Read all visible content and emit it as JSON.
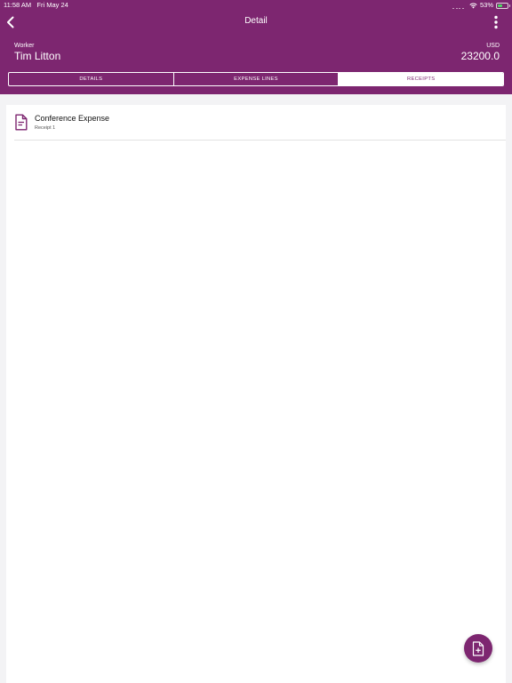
{
  "status_bar": {
    "time": "11:58 AM",
    "date": "Fri May 24",
    "battery": "53%",
    "battery_level": 0.53
  },
  "nav": {
    "title": "Detail",
    "back_icon": "chevron-left-icon",
    "more_icon": "more-vertical-icon"
  },
  "summary": {
    "worker_label": "Worker",
    "worker_name": "Tim Litton",
    "currency": "USD",
    "amount": "23200.0"
  },
  "tabs": [
    {
      "label": "DETAILS",
      "active": false
    },
    {
      "label": "EXPENSE LINES",
      "active": false
    },
    {
      "label": "RECEIPTS",
      "active": true
    }
  ],
  "receipts": [
    {
      "title": "Conference Expense",
      "subtitle": "Receipt 1",
      "icon": "document-icon"
    }
  ],
  "fab": {
    "icon": "add-document-icon"
  },
  "colors": {
    "brand": "#7d2670",
    "background": "#f3f3f5",
    "battery": "#4cd964"
  }
}
